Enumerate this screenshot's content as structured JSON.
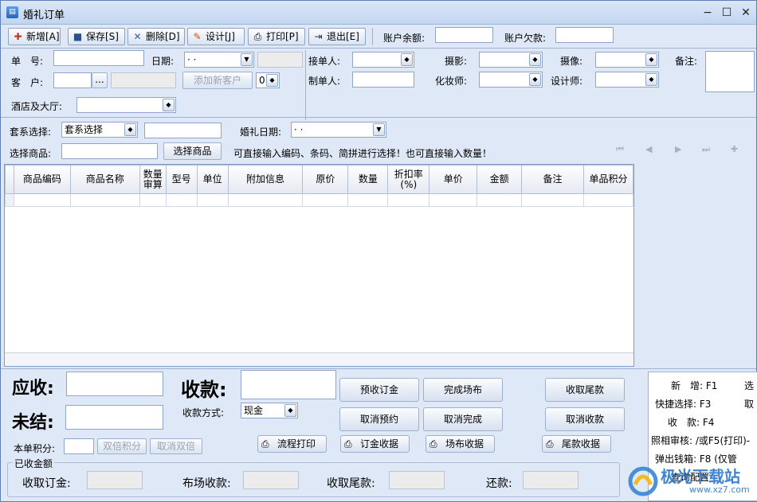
{
  "window": {
    "title": "婚礼订单",
    "icon": "order-app-icon",
    "min": "−",
    "max": "☐",
    "close": "✕"
  },
  "toolbar": {
    "buttons": [
      {
        "id": "add",
        "label": "新增[A]",
        "icon": "add-document-icon",
        "glyph": "✚"
      },
      {
        "id": "save",
        "label": "保存[S]",
        "icon": "floppy-save-icon",
        "glyph": "■"
      },
      {
        "id": "delete",
        "label": "删除[D]",
        "icon": "delete-x-icon",
        "glyph": "✕"
      },
      {
        "id": "design",
        "label": "设计[J]",
        "icon": "design-palette-icon",
        "glyph": "✎"
      },
      {
        "id": "print",
        "label": "打印[P]",
        "icon": "printer-icon",
        "glyph": "⎙"
      },
      {
        "id": "exit",
        "label": "退出[E]",
        "icon": "exit-door-icon",
        "glyph": "⇥"
      }
    ],
    "balance_label": "账户余额:",
    "balance_value": "",
    "debt_label": "账户欠款:",
    "debt_value": ""
  },
  "form": {
    "order_no_label": "单　号:",
    "order_no_value": "",
    "date_label": "日期:",
    "date_value": "· ·",
    "customer_label": "客　户:",
    "customer_browse": "...",
    "add_customer_button": "添加新客户",
    "customer_num": "0",
    "hotel_label": "酒店及大厅:",
    "hotel_value": "",
    "receiver_label": "接单人:",
    "receiver_value": "",
    "maker_label": "制单人:",
    "maker_value": "",
    "photo_label": "摄影:",
    "photo_value": "",
    "makeup_label": "化妆师:",
    "makeup_value": "",
    "video_label": "摄像:",
    "video_value": "",
    "designer_label": "设计师:",
    "designer_value": "",
    "remark_label": "备注:",
    "remark_value": ""
  },
  "package": {
    "label": "套系选择:",
    "select_value": "套系选择",
    "extra_value": "",
    "wedding_date_label": "婚礼日期:",
    "wedding_date_value": "· ·",
    "goods_label": "选择商品:",
    "goods_value": "",
    "goods_button": "选择商品",
    "hint": "可直接输入编码、条码、简拼进行选择！也可直接输入数量！",
    "nav": [
      "⏮",
      "◀",
      "▶",
      "⏭",
      "✚"
    ]
  },
  "grid": {
    "columns": [
      "商品编码",
      "商品名称",
      "数量\n审算",
      "型号",
      "单位",
      "附加信息",
      "原价",
      "数量",
      "折扣率\n(%)",
      "单价",
      "金额",
      "备注",
      "单品积分"
    ],
    "rows": []
  },
  "totals": {
    "receivable_label": "应收:",
    "receivable_value": "",
    "unsettled_label": "未结:",
    "unsettled_value": "",
    "collect_label": "收款:",
    "collect_value": "",
    "pay_method_label": "收款方式:",
    "pay_method_value": "现金",
    "points_label": "本单积分:",
    "points_value": "",
    "double_points": "双倍积分",
    "cancel_double": "取消双倍"
  },
  "actions": {
    "pre_deposit": "预收订金",
    "finish_venue": "完成场布",
    "collect_balance": "收取尾款",
    "cancel_booking": "取消预约",
    "cancel_finish": "取消完成",
    "cancel_collect": "取消收款",
    "flow_print": "流程打印",
    "deposit_receipt": "订金收据",
    "venue_receipt": "场布收据",
    "balance_receipt": "尾款收据"
  },
  "collected": {
    "group_label": "已收金额",
    "deposit_label": "收取订金:",
    "deposit_value": "",
    "venue_label": "布场收款:",
    "venue_value": "",
    "balance_label": "收取尾款:",
    "balance_value": "",
    "refund_label": "还款:",
    "refund_value": ""
  },
  "hotkeys": {
    "lines": [
      "新　增: F1",
      "快捷选择: F3",
      "收　款: F4",
      "照相审核: /或F5(打印)-",
      "弹出钱箱: F8 (仅管",
      "查询配置"
    ],
    "right": [
      "选",
      "取"
    ]
  },
  "watermark": "极光下载站",
  "watermark_url": "www.xz7.com"
}
